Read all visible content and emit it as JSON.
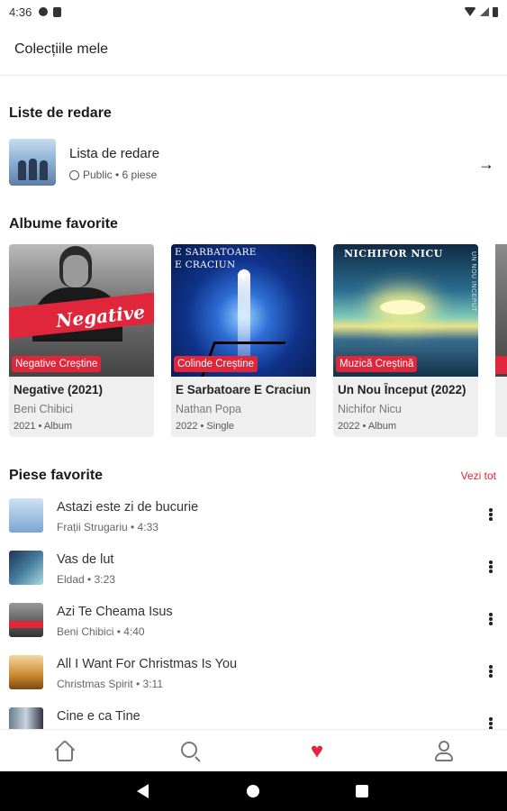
{
  "status_bar": {
    "time": "4:36"
  },
  "app_bar": {
    "title": "Colecțiile mele"
  },
  "playlists": {
    "heading": "Liste de redare",
    "items": [
      {
        "name": "Lista de redare",
        "visibility": "Public",
        "count": "6 piese",
        "meta": "Public • 6 piese"
      }
    ]
  },
  "favorite_albums": {
    "heading": "Albume favorite",
    "items": [
      {
        "tag": "Negative Creștine",
        "title": "Negative (2021)",
        "artist": "Beni Chibici",
        "meta": "2021 • Album",
        "cover_text": "Negative"
      },
      {
        "tag": "Colinde Creștine",
        "title": "E Sarbatoare E Craciun",
        "artist": "Nathan Popa",
        "meta": "2022 • Single",
        "cover_text": "E SARBATOARE\nE CRACIUN"
      },
      {
        "tag": "Muzică Creștină",
        "title": "Un Nou Început (2022)",
        "artist": "Nichifor Nicu",
        "meta": "2022 • Album",
        "cover_text": "NICHIFOR NICU"
      }
    ]
  },
  "favorite_songs": {
    "heading": "Piese favorite",
    "see_all": "Vezi tot",
    "items": [
      {
        "title": "Astazi este zi de bucurie",
        "artist": "Frații Strugariu",
        "duration": "4:33",
        "meta": "Frații Strugariu  •  4:33"
      },
      {
        "title": "Vas de lut",
        "artist": "Eldad",
        "duration": "3:23",
        "meta": "Eldad  •  3:23"
      },
      {
        "title": "Azi Te Cheama Isus",
        "artist": "Beni Chibici",
        "duration": "4:40",
        "meta": "Beni Chibici  •  4:40"
      },
      {
        "title": "All I Want For Christmas Is You",
        "artist": "Christmas Spirit",
        "duration": "3:11",
        "meta": "Christmas Spirit  •  3:11"
      },
      {
        "title": "Cine e ca Tine",
        "artist": "",
        "duration": "",
        "meta": ""
      }
    ]
  },
  "bottom_nav": [
    {
      "icon": "home-icon",
      "active": false
    },
    {
      "icon": "search-icon",
      "active": false
    },
    {
      "icon": "heart-icon",
      "active": true
    },
    {
      "icon": "profile-icon",
      "active": false
    }
  ],
  "colors": {
    "accent": "#e0263a",
    "card_bg": "#efefef",
    "text": "#222222",
    "muted": "#777777"
  }
}
